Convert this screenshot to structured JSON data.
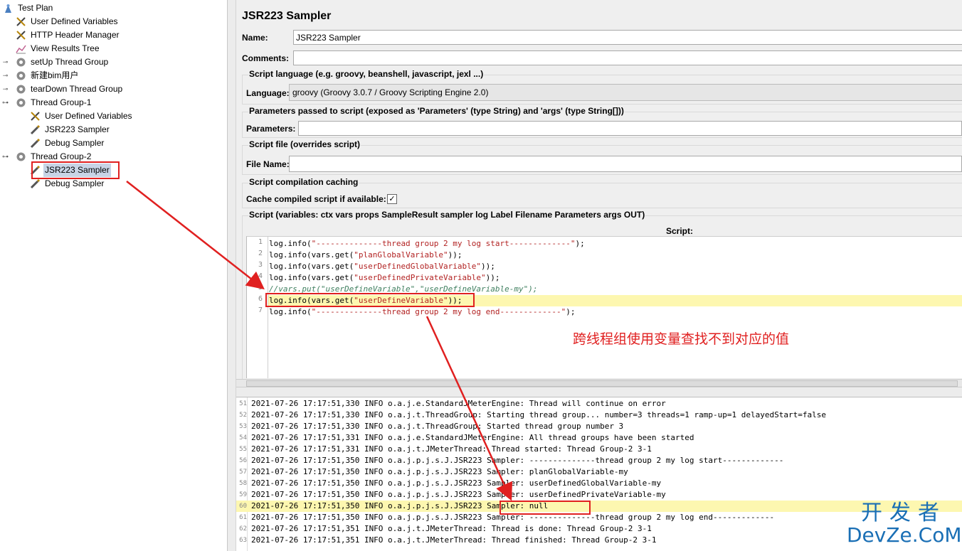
{
  "tree": {
    "nodes": [
      {
        "label": "Test Plan",
        "icon": "test-plan-icon"
      },
      {
        "label": "User Defined Variables",
        "icon": "wrench-icon"
      },
      {
        "label": "HTTP Header Manager",
        "icon": "wrench-icon"
      },
      {
        "label": "View Results Tree",
        "icon": "chart-icon"
      },
      {
        "label": "setUp Thread Group",
        "icon": "gear-icon"
      },
      {
        "label": "新建bim用户",
        "icon": "gear-icon"
      },
      {
        "label": "tearDown Thread Group",
        "icon": "gear-icon"
      },
      {
        "label": "Thread Group-1",
        "icon": "gear-icon"
      },
      {
        "label": "User Defined Variables",
        "icon": "wrench-icon"
      },
      {
        "label": "JSR223 Sampler",
        "icon": "pencil-icon"
      },
      {
        "label": "Debug Sampler",
        "icon": "pencil-icon"
      },
      {
        "label": "Thread Group-2",
        "icon": "gear-icon"
      },
      {
        "label": "JSR223 Sampler",
        "icon": "pencil-icon"
      },
      {
        "label": "Debug Sampler",
        "icon": "pencil-icon"
      }
    ]
  },
  "panel": {
    "title": "JSR223 Sampler",
    "name_label": "Name:",
    "name_value": "JSR223 Sampler",
    "comments_label": "Comments:",
    "comments_value": "",
    "lang_group": "Script language (e.g. groovy, beanshell, javascript, jexl ...)",
    "lang_label": "Language:",
    "lang_value": "groovy     (Groovy 3.0.7 / Groovy Scripting Engine 2.0)",
    "params_group": "Parameters passed to script (exposed as 'Parameters' (type String) and 'args' (type String[]))",
    "params_label": "Parameters:",
    "file_group": "Script file (overrides script)",
    "file_label": "File Name:",
    "cache_group": "Script compilation caching",
    "cache_label": "Cache compiled script if available:",
    "cache_checked": "✓",
    "script_group": "Script (variables: ctx vars props SampleResult sampler log Label Filename Parameters args OUT)",
    "script_header": "Script:"
  },
  "script_lines": [
    {
      "num": "1",
      "pre": "log.info(",
      "str": "\"--------------thread group 2 my log start-------------\"",
      "post": ");",
      "comment": ""
    },
    {
      "num": "2",
      "pre": "log.info(vars.get(",
      "str": "\"planGlobalVariable\"",
      "post": "));",
      "comment": ""
    },
    {
      "num": "3",
      "pre": "log.info(vars.get(",
      "str": "\"userDefinedGlobalVariable\"",
      "post": "));",
      "comment": ""
    },
    {
      "num": "4",
      "pre": "log.info(vars.get(",
      "str": "\"userDefinedPrivateVariable\"",
      "post": "));",
      "comment": ""
    },
    {
      "num": "5",
      "pre": "",
      "str": "",
      "post": "",
      "comment": "//vars.put(\"userDefineVariable\",\"userDefineVariable-my\");"
    },
    {
      "num": "6",
      "pre": "log.info(vars.get(",
      "str": "\"userDefineVariable\"",
      "post": "));",
      "comment": ""
    },
    {
      "num": "7",
      "pre": "log.info(",
      "str": "\"--------------thread group 2 my log end-------------\"",
      "post": ");",
      "comment": ""
    }
  ],
  "log_lines": [
    {
      "num": "51",
      "text": "2021-07-26 17:17:51,330 INFO o.a.j.e.StandardJMeterEngine: Thread will continue on error"
    },
    {
      "num": "52",
      "text": "2021-07-26 17:17:51,330 INFO o.a.j.t.ThreadGroup: Starting thread group... number=3 threads=1 ramp-up=1 delayedStart=false"
    },
    {
      "num": "53",
      "text": "2021-07-26 17:17:51,330 INFO o.a.j.t.ThreadGroup: Started thread group number 3"
    },
    {
      "num": "54",
      "text": "2021-07-26 17:17:51,331 INFO o.a.j.e.StandardJMeterEngine: All thread groups have been started"
    },
    {
      "num": "55",
      "text": "2021-07-26 17:17:51,331 INFO o.a.j.t.JMeterThread: Thread started: Thread Group-2 3-1"
    },
    {
      "num": "56",
      "text": "2021-07-26 17:17:51,350 INFO o.a.j.p.j.s.J.JSR223 Sampler: --------------thread group 2 my log start-------------"
    },
    {
      "num": "57",
      "text": "2021-07-26 17:17:51,350 INFO o.a.j.p.j.s.J.JSR223 Sampler: planGlobalVariable-my"
    },
    {
      "num": "58",
      "text": "2021-07-26 17:17:51,350 INFO o.a.j.p.j.s.J.JSR223 Sampler: userDefinedGlobalVariable-my"
    },
    {
      "num": "59",
      "text": "2021-07-26 17:17:51,350 INFO o.a.j.p.j.s.J.JSR223 Sampler: userDefinedPrivateVariable-my"
    },
    {
      "num": "60",
      "text": "2021-07-26 17:17:51,350 INFO o.a.j.p.j.s.J.JSR223 Sampler: null"
    },
    {
      "num": "61",
      "text": "2021-07-26 17:17:51,350 INFO o.a.j.p.j.s.J.JSR223 Sampler: --------------thread group 2 my log end-------------"
    },
    {
      "num": "62",
      "text": "2021-07-26 17:17:51,351 INFO o.a.j.t.JMeterThread: Thread is done: Thread Group-2 3-1"
    },
    {
      "num": "63",
      "text": "2021-07-26 17:17:51,351 INFO o.a.j.t.JMeterThread: Thread finished: Thread Group-2 3-1"
    }
  ],
  "annotation": "跨线程组使用变量查找不到对应的值",
  "watermark": {
    "line1": "开发者",
    "line2": "DevZe.CoM"
  },
  "colors": {
    "accent_red": "#e02020",
    "highlight": "#fdf7b0",
    "selection": "#c8d4e6",
    "watermark": "#1a6fb5"
  }
}
